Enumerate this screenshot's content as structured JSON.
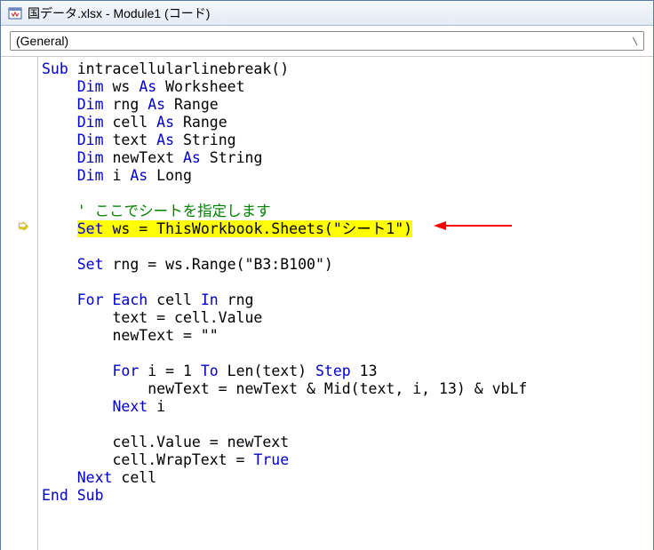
{
  "window": {
    "title": "国データ.xlsx - Module1 (コード)"
  },
  "dropdown": {
    "value": "(General)"
  },
  "gutter": {
    "arrow_glyph": "➭"
  },
  "code": {
    "sub_kw": "Sub",
    "sub_name": " intracellularlinebreak()",
    "dim_kw": "Dim",
    "as_kw": "As",
    "decl_ws": " ws ",
    "type_ws": " Worksheet",
    "decl_rng": " rng ",
    "type_rng": " Range",
    "decl_cell": " cell ",
    "type_cell": " Range",
    "decl_text": " text ",
    "type_text": " String",
    "decl_new": " newText ",
    "type_new": " String",
    "decl_i": " i ",
    "type_i": " Long",
    "comment_line": "    ' ここでシートを指定します",
    "set_kw": "Set",
    "hl_line": " ws = ThisWorkbook.Sheets(\"シート1\")",
    "set_rng": " rng = ws.Range(\"B3:B100\")",
    "for_kw": "For",
    "each_kw": "Each",
    "in_kw": "In",
    "for_each_mid": " cell ",
    "for_each_end": " rng",
    "body_text_val": "        text = cell.Value",
    "body_newtext": "        newText = \"\"",
    "to_kw": "To",
    "step_kw": "Step",
    "for_i_pre": " i = 1 ",
    "for_i_mid": " Len(text) ",
    "for_i_end": " 13",
    "body_concat": "            newText = newText & Mid(text, i, 13) & vbLf",
    "next_kw": "Next",
    "next_i": " i",
    "body_cellval": "        cell.Value = newText",
    "true_kw": "True",
    "body_wrap_pre": "        cell.WrapText = ",
    "next_cell": " cell",
    "end_sub_kw": "End Sub"
  }
}
